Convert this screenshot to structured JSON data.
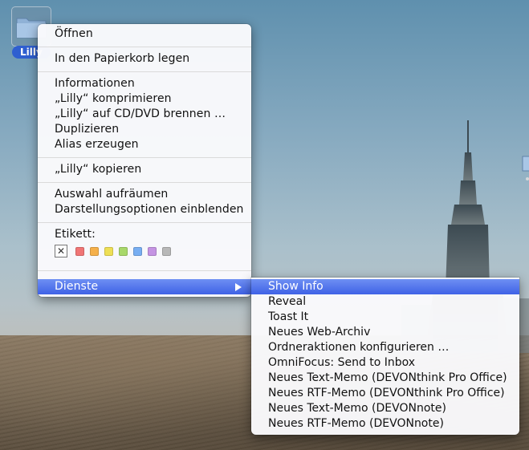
{
  "desktop": {
    "folder_label": "Lilly"
  },
  "context_menu": {
    "items": [
      {
        "label": "Öffnen"
      },
      {
        "label": "In den Papierkorb legen"
      },
      {
        "label": "Informationen"
      },
      {
        "label": "„Lilly“ komprimieren"
      },
      {
        "label": "„Lilly“ auf CD/DVD brennen …"
      },
      {
        "label": "Duplizieren"
      },
      {
        "label": "Alias erzeugen"
      },
      {
        "label": "„Lilly“ kopieren"
      },
      {
        "label": "Auswahl aufräumen"
      },
      {
        "label": "Darstellungsoptionen einblenden"
      },
      {
        "label": "Etikett:"
      },
      {
        "label": "Dienste"
      }
    ],
    "label_colors": [
      "#f07575",
      "#f5b04a",
      "#eedf55",
      "#a8d86a",
      "#78aef2",
      "#c594e3",
      "#b8b8b8"
    ],
    "selection_color": "#3f62e6"
  },
  "services_submenu": {
    "items": [
      {
        "label": "Show Info"
      },
      {
        "label": "Reveal"
      },
      {
        "label": "Toast It"
      },
      {
        "label": "Neues Web-Archiv"
      },
      {
        "label": "Ordneraktionen konfigurieren …"
      },
      {
        "label": "OmniFocus: Send to Inbox"
      },
      {
        "label": "Neues Text-Memo (DEVONthink Pro Office)"
      },
      {
        "label": "Neues RTF-Memo (DEVONthink Pro Office)"
      },
      {
        "label": "Neues Text-Memo (DEVONnote)"
      },
      {
        "label": "Neues RTF-Memo (DEVONnote)"
      }
    ]
  }
}
